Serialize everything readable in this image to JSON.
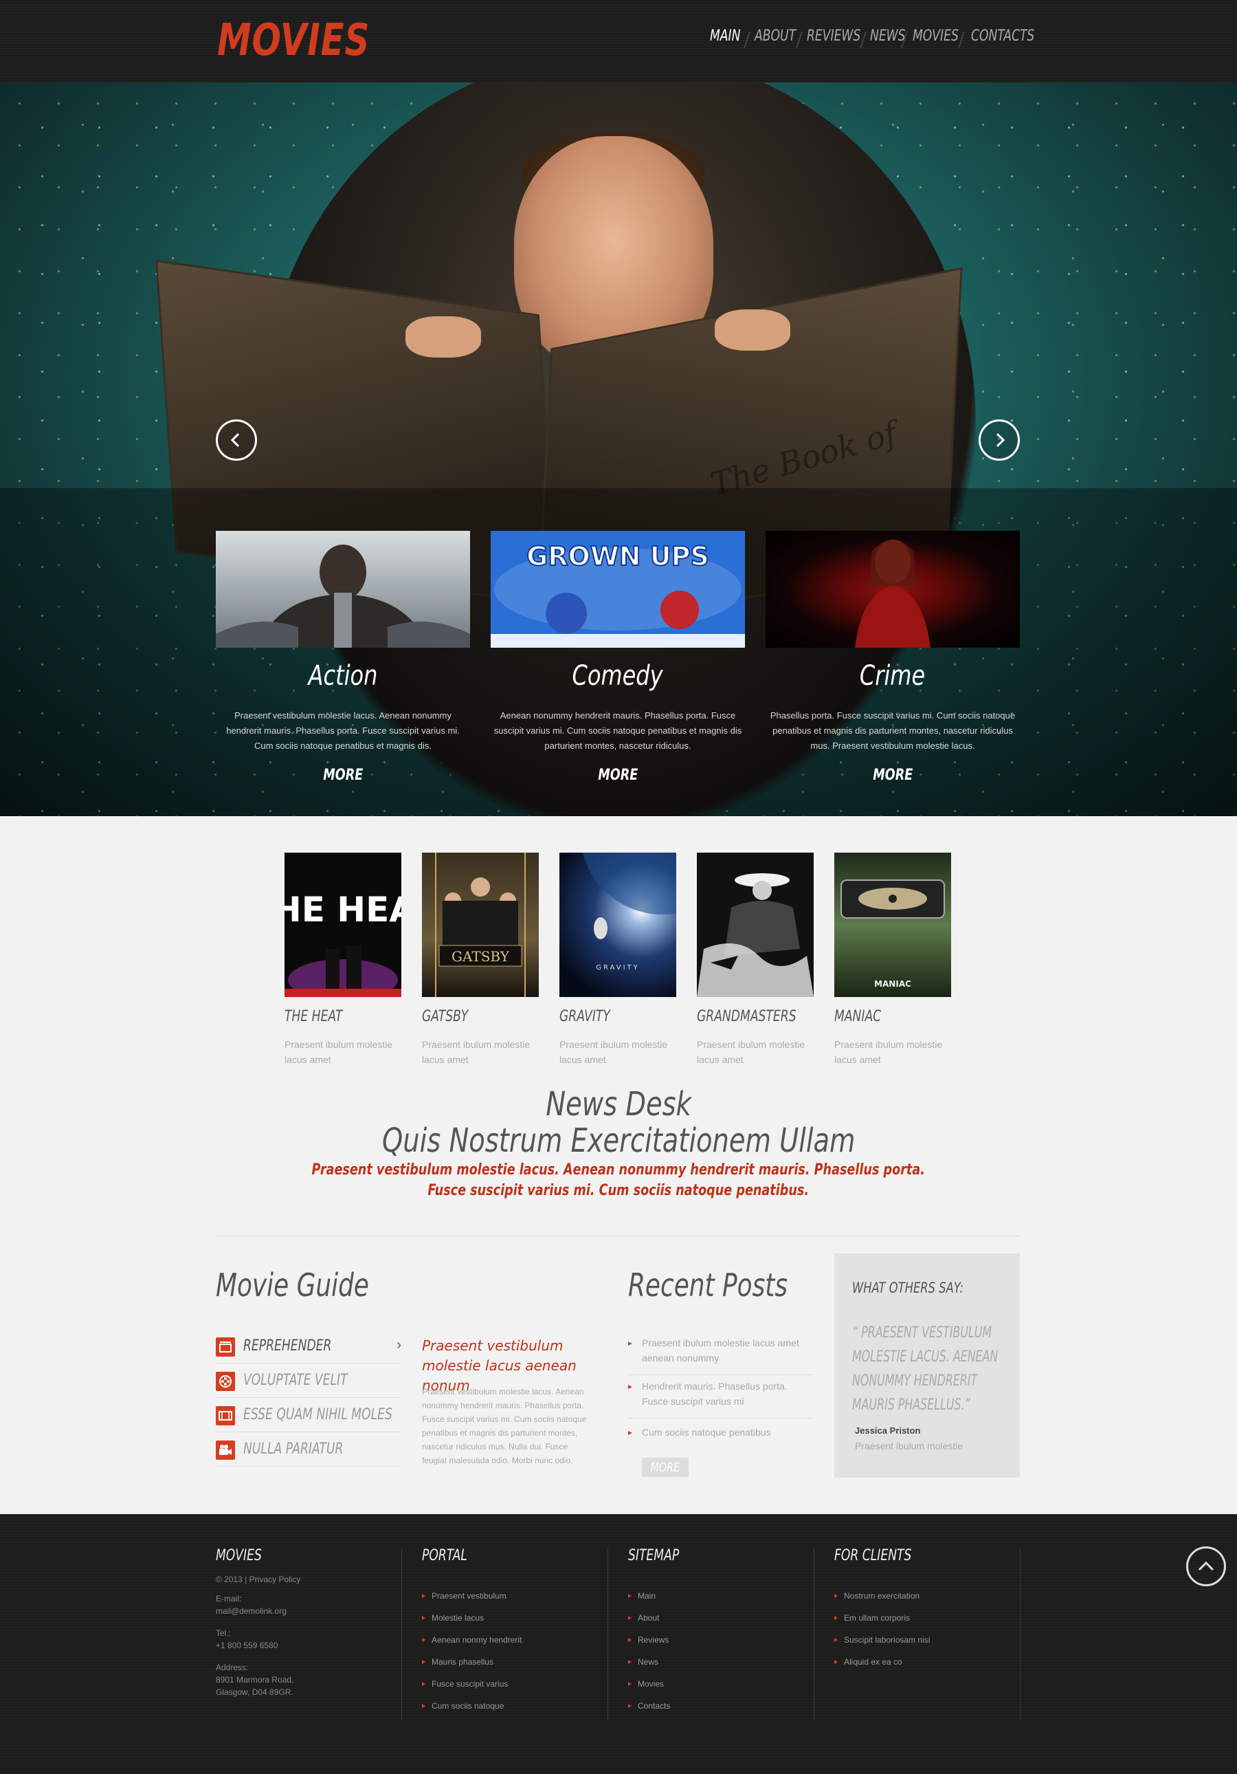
{
  "header": {
    "logo": "MOVIES",
    "nav": [
      "MAIN",
      "ABOUT",
      "REVIEWS",
      "NEWS",
      "MOVIES",
      "CONTACTS"
    ]
  },
  "hero": {
    "book_text": "The Book of",
    "genres": [
      {
        "title": "Action",
        "text": "Praesent vestibulum molestie lacus. Aenean nonummy hendrerit mauris. Phasellus porta. Fusce suscipit varius mi. Cum sociis natoque penatibus et magnis dis.",
        "more": "MORE"
      },
      {
        "title": "Comedy",
        "image_text": "GROWN UPS",
        "text": "Aenean nonummy hendrerit mauris. Phasellus porta. Fusce suscipit varius mi. Cum sociis natoque penatibus et magnis dis parturient montes, nascetur ridiculus.",
        "more": "MORE"
      },
      {
        "title": "Crime",
        "text": "Phasellus porta. Fusce suscipit varius mi. Cum sociis natoque penatibus et magnis dis parturient montes, nascetur ridiculus mus. Praesent vestibulum molestie lacus.",
        "more": "MORE"
      }
    ]
  },
  "movies": [
    {
      "title": "THE HEAT",
      "poster_text": "THE HEAT",
      "desc": "Praesent ibulum molestie lacus amet"
    },
    {
      "title": "GATSBY",
      "poster_text": "GATSBY",
      "desc": "Praesent ibulum molestie lacus amet"
    },
    {
      "title": "GRAVITY",
      "poster_text": "GRAVITY",
      "desc": "Praesent ibulum molestie lacus amet"
    },
    {
      "title": "GRANDMASTERS",
      "poster_text": "",
      "desc": "Praesent ibulum molestie lacus amet"
    },
    {
      "title": "MANIAC",
      "poster_text": "MANIAC",
      "desc": "Praesent ibulum molestie lacus amet"
    }
  ],
  "newsdesk": {
    "title": "News Desk",
    "subtitle": "Quis Nostrum Exercitationem Ullam",
    "text_line1": "Praesent vestibulum molestie lacus. Aenean nonummy hendrerit mauris. Phasellus porta.",
    "text_line2": "Fusce suscipit varius mi. Cum sociis natoque penatibus."
  },
  "movie_guide": {
    "title": "Movie Guide",
    "items": [
      {
        "label": "REPREHENDER",
        "icon": "clapperboard-icon"
      },
      {
        "label": "VOLUPTATE VELIT",
        "icon": "film-reel-icon"
      },
      {
        "label": "ESSE QUAM NIHIL MOLES",
        "icon": "film-strip-icon"
      },
      {
        "label": "NULLA PARIATUR",
        "icon": "movie-camera-icon"
      }
    ],
    "feature_title": "Praesent vestibulum molestie lacus aenean nonum",
    "feature_text": "Praesent vestibulum molestie lacus. Aenean nonummy hendrerit mauris. Phasellus porta. Fusce suscipit varius mi. Cum sociis natoque penatibus et magnis dis parturient montes, nascetur ridiculus mus. Nulla dui. Fusce feugiat malesuada odio. Morbi nunc odio."
  },
  "recent_posts": {
    "title": "Recent Posts",
    "items": [
      "Praesent ibulum molestie lacus amet aenean nonummy",
      "Hendrerit mauris. Phasellus porta. Fusce suscipit varius mi",
      "Cum sociis natoque penatibus"
    ],
    "more": "MORE"
  },
  "testimonial": {
    "heading": "WHAT OTHERS SAY:",
    "quote": "“ PRAESENT VESTIBULUM MOLESTIE LACUS. AENEAN NONUMMY HENDRERIT MAURIS PHASELLUS.”",
    "name": "Jessica Priston",
    "role": "Praesent ibulum molestie"
  },
  "footer": {
    "col1": {
      "title": "MOVIES",
      "copyright": "© 2013 | Privacy Policy",
      "email_label": "E-mail:",
      "email": "mail@demolink.org",
      "tel_label": "Tel.:",
      "tel": "+1 800 559 6580",
      "address_label": "Address:",
      "address_line1": "8901 Marmora Road,",
      "address_line2": "Glasgow, D04 89GR."
    },
    "portal": {
      "title": "PORTAL",
      "links": [
        "Praesent vestibulum",
        "Molestie lacus",
        "Aenean nonmy hendrerit",
        "Mauris phasellus",
        "Fusce suscipit varius",
        "Cum sociis natoque"
      ]
    },
    "sitemap": {
      "title": "SITEMAP",
      "links": [
        "Main",
        "About",
        "Reviews",
        "News",
        "Movies",
        "Contacts"
      ]
    },
    "clients": {
      "title": "FOR CLIENTS",
      "links": [
        "Nostrum exercitation",
        "Em ullam corporis",
        "Suscipit laboriosam nisi",
        "Aliquid ex ea co"
      ]
    }
  },
  "colors": {
    "accent": "#d13c1e",
    "header_bg": "#1c1c1c",
    "body_bg": "#f2f2f2",
    "hero_teal": "#1d6562"
  }
}
